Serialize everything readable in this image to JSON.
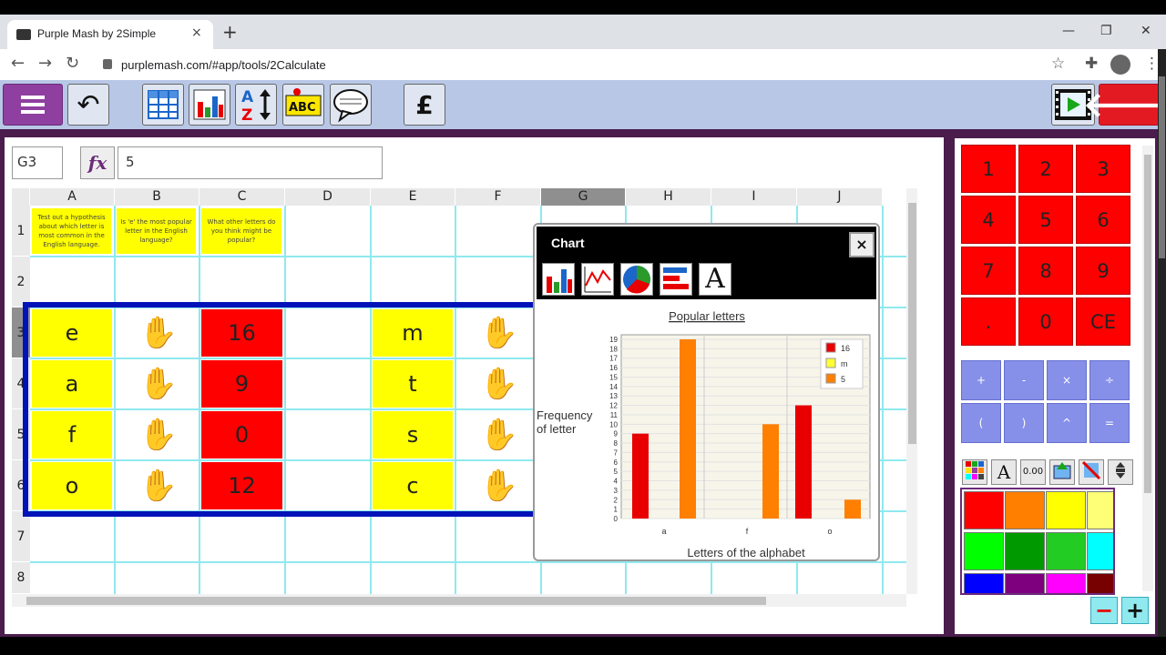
{
  "browser": {
    "tab_title": "Purple Mash by 2Simple",
    "tab_close": "×",
    "new_tab": "+",
    "url": "purplemash.com/#app/tools/2Calculate",
    "minimize": "—",
    "restore": "❐",
    "close": "✕",
    "back": "←",
    "forward": "→",
    "reload": "↻",
    "star": "☆",
    "extensions": "✚",
    "more": "⋮"
  },
  "app": {
    "undo_glyph": "↶",
    "pound_label": "£",
    "back_glyph": "🡐",
    "cell_ref": "G3",
    "fx_label": "fx",
    "formula_value": "5"
  },
  "sheet": {
    "columns": [
      "A",
      "B",
      "C",
      "D",
      "E",
      "F",
      "G",
      "H",
      "I",
      "J"
    ],
    "selected_column": "G",
    "rows": [
      "1",
      "2",
      "3",
      "4",
      "5",
      "6",
      "7",
      "8"
    ],
    "selected_row": "3",
    "notes": [
      "Test out a hypothesis about which letter is most common in the English language.",
      "Is 'e' the most popular letter in the English language?",
      "What other letters do you think might be popular?"
    ],
    "letters_left": [
      "e",
      "a",
      "f",
      "o"
    ],
    "counts": [
      "16",
      "9",
      "0",
      "12"
    ],
    "letters_right": [
      "m",
      "t",
      "s",
      "c"
    ],
    "hand_glyph": "✋"
  },
  "chart_dialog": {
    "title": "Chart",
    "close_label": "×",
    "text_tool_label": "A"
  },
  "chart_data": {
    "type": "bar",
    "title": "Popular letters",
    "xlabel": "Letters of the alphabet",
    "ylabel": "Frequency of letter",
    "ylabel_lines": [
      "Frequency",
      "of letter"
    ],
    "ylim": [
      0,
      19
    ],
    "yticks": [
      0,
      1,
      2,
      3,
      4,
      5,
      6,
      7,
      8,
      9,
      10,
      11,
      12,
      13,
      14,
      15,
      16,
      17,
      18,
      19
    ],
    "categories": [
      "a",
      "f",
      "o"
    ],
    "bars": [
      {
        "category": "a",
        "value": 9,
        "color": "#e80000"
      },
      {
        "category": "a",
        "value": 19,
        "color": "#ff7f00"
      },
      {
        "category": "f",
        "value": 10,
        "color": "#ff7f00"
      },
      {
        "category": "f",
        "value": 12,
        "color": "#e80000"
      },
      {
        "category": "o",
        "value": 2,
        "color": "#ff7f00"
      }
    ],
    "legend": [
      {
        "label": "16",
        "color": "#e80000"
      },
      {
        "label": "m",
        "color": "#ffff33"
      },
      {
        "label": "5",
        "color": "#ff7f00"
      }
    ],
    "grid": true,
    "legend_position": "top-right"
  },
  "keypad": {
    "keys": [
      "1",
      "2",
      "3",
      "4",
      "5",
      "6",
      "7",
      "8",
      "9",
      ".",
      "0",
      "CE"
    ],
    "operators": [
      "+",
      "-",
      "×",
      "÷",
      "(",
      ")",
      "^",
      "="
    ]
  },
  "format_tools": {
    "font_label": "A",
    "decimal_label": "0.00"
  },
  "palette": {
    "colors": [
      "#ff0000",
      "#ff7f00",
      "#ffff00",
      "#ffff77",
      "#00ff00",
      "#009900",
      "#22cc22",
      "#00ffff",
      "#0000ff",
      "#7f007f",
      "#ff00ff",
      "#770000"
    ]
  },
  "zoom": {
    "minus": "−",
    "plus": "+"
  },
  "colors": {
    "brand_purple": "#8e3fa0",
    "app_bar": "#b8c7e6",
    "accent_red": "#e41a23",
    "grid_line": "#8fe9ee",
    "selection_frame": "#0012b8"
  }
}
